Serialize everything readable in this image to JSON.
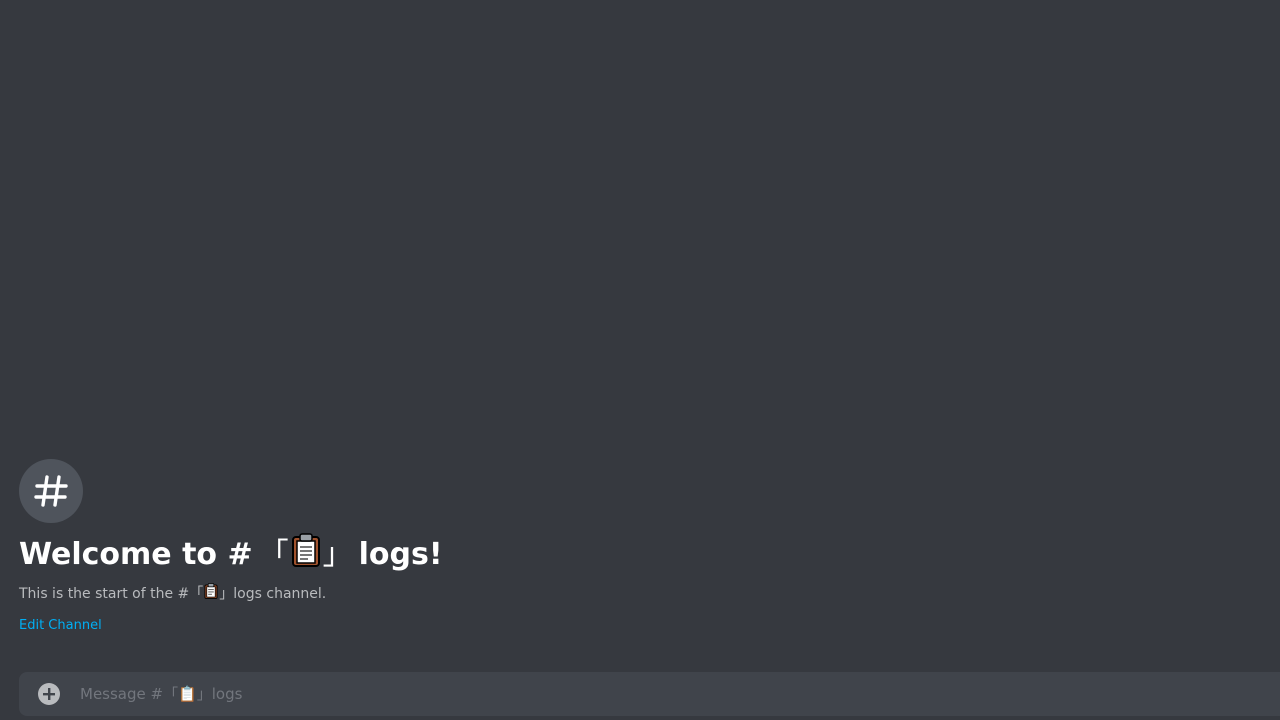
{
  "channel": {
    "name": "「📋」logs"
  },
  "welcome": {
    "title_prefix": "Welcome to #",
    "title_bracket_open": "「",
    "title_bracket_close": "」",
    "title_suffix": "logs!",
    "desc_prefix": "This is the start of the #",
    "desc_bracket_open": "「",
    "desc_bracket_close": "」",
    "desc_suffix": "logs channel.",
    "edit_link": "Edit Channel"
  },
  "composer": {
    "placeholder": "Message #「📋」logs"
  },
  "icons": {
    "channel": "hash-icon",
    "clipboard": "clipboard-icon",
    "attach": "add-circle-icon"
  },
  "colors": {
    "background": "#36393f",
    "input_background": "#40444b",
    "link": "#00aff4",
    "heading": "#ffffff",
    "muted": "#b9bbbe",
    "placeholder": "#72767d"
  }
}
